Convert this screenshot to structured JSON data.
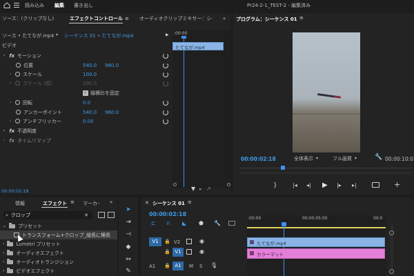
{
  "topbar": {
    "home_icon": "home-icon",
    "menu_icon": "hamburger-icon",
    "tabs": [
      {
        "label": "読み込み"
      },
      {
        "label": "編集"
      },
      {
        "label": "書き出し"
      }
    ],
    "project_title": "Pr24-2-1_TEST-2 - 編集済み"
  },
  "effect_controls": {
    "tabs": [
      {
        "label": "ソース：(クリップなし)"
      },
      {
        "label": "エフェクトコントロール"
      },
      {
        "label": "オーディオクリップミキサー：シーケ"
      }
    ],
    "source_label": "ソース • たてなが.mp4",
    "sequence_label": "シーケンス 01 • たてなが.mp4",
    "ruler_time": ":00:00",
    "clip_label": "たてなが.mp4",
    "section_video": "ビデオ",
    "rows": [
      {
        "label": "モーション",
        "v1": "",
        "v2": ""
      },
      {
        "label": "位置",
        "v1": "540.0",
        "v2": "960.0"
      },
      {
        "label": "スケール",
        "v1": "100.0",
        "v2": ""
      },
      {
        "label": "スケール (幅)",
        "v1": "100.0",
        "v2": ""
      },
      {
        "label": "縦横比を固定",
        "v1": "",
        "v2": ""
      },
      {
        "label": "回転",
        "v1": "0.0",
        "v2": ""
      },
      {
        "label": "アンカーポイント",
        "v1": "540.0",
        "v2": "960.0"
      },
      {
        "label": "アンチフリッカー",
        "v1": "0.00",
        "v2": ""
      },
      {
        "label": "不透明度",
        "v1": "",
        "v2": ""
      },
      {
        "label": "タイムリマップ",
        "v1": "",
        "v2": ""
      }
    ],
    "timecode": "00:00:02:18"
  },
  "program": {
    "title": "プログラム：シーケンス 01",
    "timecode": "00:00:02:18",
    "zoom": "全体表示",
    "quality": "フル画質",
    "duration": "00:00:10:0"
  },
  "effects_panel": {
    "tabs": [
      {
        "label": "情報"
      },
      {
        "label": "エフェクト"
      },
      {
        "label": "マーカー"
      }
    ],
    "search_value": "クロップ",
    "items": [
      {
        "label": "プリセット"
      },
      {
        "label": "トランスフォーム+クロップ_縦長に横長"
      },
      {
        "label": "Lumetri プリセット"
      },
      {
        "label": "オーディオエフェクト"
      },
      {
        "label": "オーディオトランジション"
      },
      {
        "label": "ビデオエフェクト"
      }
    ]
  },
  "timeline": {
    "title": "シーケンス 01",
    "timecode": "00:00:02:18",
    "ruler": [
      ":00:00",
      "00:00:05:00",
      "00:0"
    ],
    "tracks": [
      {
        "src": "V1",
        "name": "V2"
      },
      {
        "src": "",
        "name": "V1"
      },
      {
        "src": "A1",
        "name": "A1"
      }
    ],
    "clips": [
      {
        "label": "たてなが.mp4",
        "color": "#8ab4e6"
      },
      {
        "label": "カラーマット",
        "color": "#e47fd9"
      }
    ]
  },
  "colors": {
    "accent": "#2d8ceb",
    "video_clip": "#8ab4e6",
    "matte_clip": "#e47fd9"
  }
}
